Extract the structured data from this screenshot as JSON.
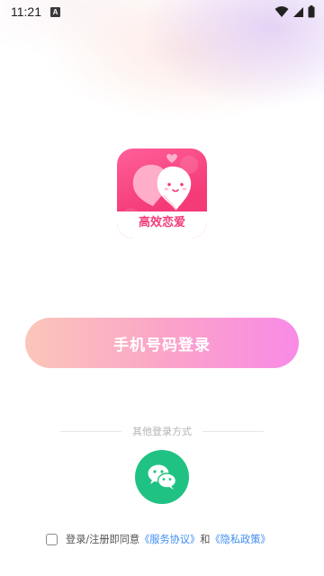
{
  "status_bar": {
    "time": "11:21",
    "notification_badge": "A",
    "icons": [
      "wifi-icon",
      "signal-icon",
      "battery-icon"
    ]
  },
  "logo": {
    "label": "高效恋爱",
    "icon": "peach-hearts-logo",
    "colors": {
      "background": "#f43b78",
      "label": "#f23c78"
    }
  },
  "login": {
    "phone_button_label": "手机号码登录",
    "other_methods_label": "其他登录方式",
    "wechat_icon": "wechat-icon"
  },
  "agreement": {
    "prefix": "登录/注册即同意",
    "service_link": "《服务协议》",
    "conjunction": "和",
    "privacy_link": "《隐私政策》",
    "checked": false
  },
  "colors": {
    "accent_gradient_start": "#fbc6b9",
    "accent_gradient_end": "#f98ae6",
    "wechat": "#20c283",
    "link": "#3d8ef0"
  }
}
